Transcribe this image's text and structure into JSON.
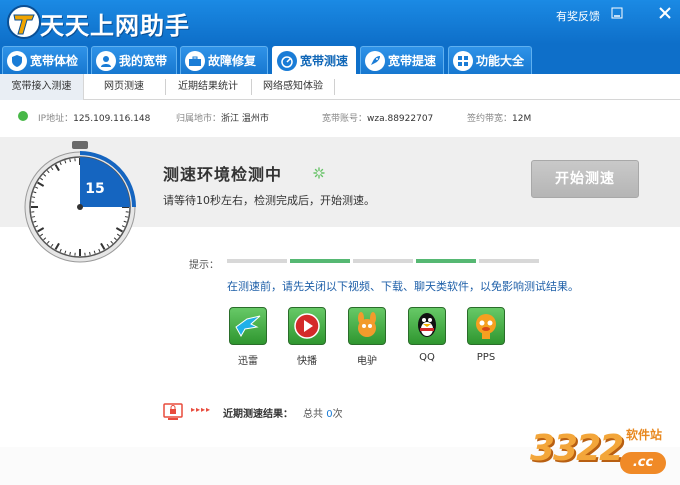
{
  "window": {
    "title": "天天上网助手",
    "feedback_link": "有奖反馈",
    "controls": [
      "minimize-icon",
      "close-icon"
    ]
  },
  "nav": {
    "tabs": [
      {
        "label": "宽带体检",
        "icon": "shield-icon"
      },
      {
        "label": "我的宽带",
        "icon": "person-icon"
      },
      {
        "label": "故障修复",
        "icon": "toolbox-icon"
      },
      {
        "label": "宽带测速",
        "icon": "speedometer-icon",
        "active": true
      },
      {
        "label": "宽带提速",
        "icon": "rocket-icon"
      },
      {
        "label": "功能大全",
        "icon": "grid-icon"
      }
    ]
  },
  "subnav": {
    "tabs": [
      {
        "label": "宽带接入测速",
        "active": true
      },
      {
        "label": "网页测速"
      },
      {
        "label": "近期结果统计"
      },
      {
        "label": "网络感知体验"
      }
    ]
  },
  "info": {
    "ip_label": "IP地址：",
    "ip_value": "125.109.116.148",
    "region_label": "归属地市：",
    "region_value": "浙江 温州市",
    "account_label": "宽带账号：",
    "account_value": "wza.88922707",
    "bandwidth_label": "签约带宽：",
    "bandwidth_value": "12M"
  },
  "test": {
    "title": "测速环境检测中",
    "description": "请等待10秒左右，检测完成后，开始测速。",
    "start_button": "开始测速",
    "countdown": "15",
    "countdown_fraction": 0.25
  },
  "tips": {
    "label": "提示：",
    "steps_done": [
      false,
      true,
      false,
      true,
      false
    ],
    "message": "在测速前，请先关闭以下视频、下载、聊天类软件，以免影响测试结果。",
    "apps": [
      {
        "label": "迅雷",
        "icon": "thunder-bird-icon"
      },
      {
        "label": "快播",
        "icon": "play-icon"
      },
      {
        "label": "电驴",
        "icon": "donkey-icon"
      },
      {
        "label": "QQ",
        "icon": "penguin-icon"
      },
      {
        "label": "PPS",
        "icon": "pps-icon"
      }
    ]
  },
  "recent": {
    "label": "近期测速结果：",
    "total_prefix": "总共",
    "count": "0",
    "total_suffix": "次"
  },
  "watermark": {
    "number": "3322",
    "sub": "软件站",
    "domain": ".cc"
  },
  "colors": {
    "brand_blue": "#0e6fc9",
    "progress_on": "#56b873",
    "progress_off": "#d8d8d8",
    "tip_text": "#1e5fa8"
  }
}
